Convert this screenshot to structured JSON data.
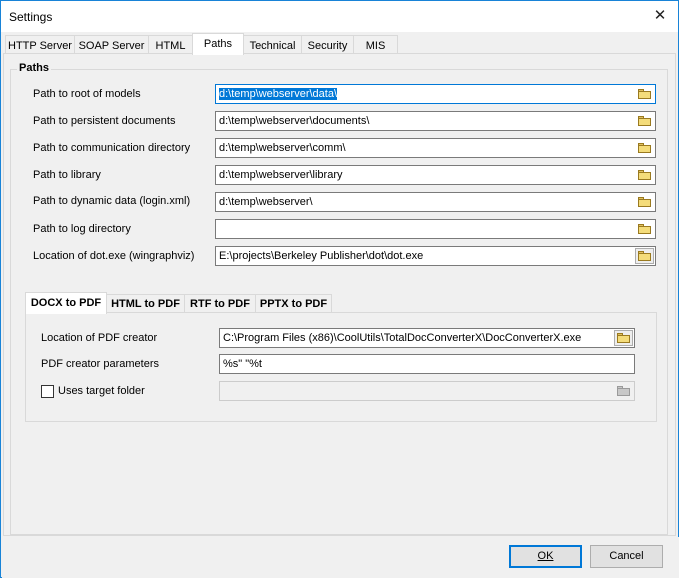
{
  "window": {
    "title": "Settings"
  },
  "tabs": [
    {
      "label": "HTTP Server"
    },
    {
      "label": "SOAP Server"
    },
    {
      "label": "HTML"
    },
    {
      "label": "Paths"
    },
    {
      "label": "Technical"
    },
    {
      "label": "Security"
    },
    {
      "label": "MIS"
    }
  ],
  "active_tab": "Paths",
  "paths_group": {
    "title": "Paths",
    "rows": [
      {
        "label": "Path to root of models",
        "value": "d:\\temp\\webserver\\data\\"
      },
      {
        "label": "Path to persistent documents",
        "value": "d:\\temp\\webserver\\documents\\"
      },
      {
        "label": "Path to communication directory",
        "value": "d:\\temp\\webserver\\comm\\"
      },
      {
        "label": "Path to library",
        "value": "d:\\temp\\webserver\\library"
      },
      {
        "label": "Path to dynamic data (login.xml)",
        "value": "d:\\temp\\webserver\\"
      },
      {
        "label": "Path to log directory",
        "value": ""
      },
      {
        "label": "Location of dot.exe (wingraphviz)",
        "value": "E:\\projects\\Berkeley Publisher\\dot\\dot.exe"
      }
    ]
  },
  "sub_tabs": [
    {
      "label": "DOCX to PDF"
    },
    {
      "label": "HTML to PDF"
    },
    {
      "label": "RTF to PDF"
    },
    {
      "label": "PPTX to PDF"
    }
  ],
  "pdf": {
    "creator_label": "Location of PDF creator",
    "creator_value": "C:\\Program Files (x86)\\CoolUtils\\TotalDocConverterX\\DocConverterX.exe",
    "params_label": "PDF creator parameters",
    "params_value": "%s\" \"%t",
    "uses_target_label": "Uses target folder",
    "uses_target_checked": false,
    "target_value": ""
  },
  "buttons": {
    "ok": "OK",
    "cancel": "Cancel"
  },
  "colors": {
    "accent": "#0078d7",
    "window_border": "#1883d7"
  }
}
